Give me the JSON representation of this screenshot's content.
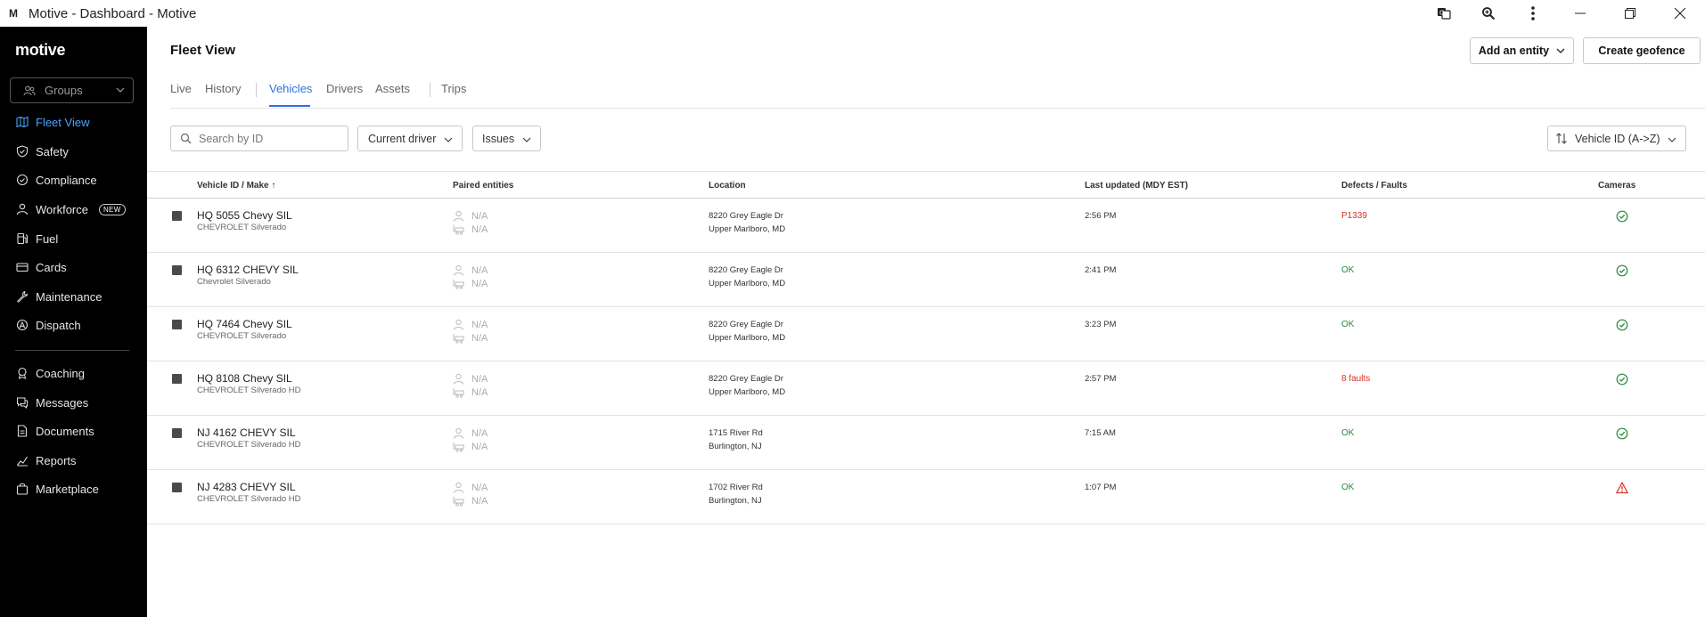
{
  "window": {
    "title": "Motive - Dashboard - Motive",
    "logo_text": "M"
  },
  "sidebar": {
    "logo": "motive",
    "groups_label": "Groups",
    "items": [
      {
        "label": "Fleet View",
        "icon": "map-icon",
        "active": true
      },
      {
        "label": "Safety",
        "icon": "shield-icon"
      },
      {
        "label": "Compliance",
        "icon": "compliance-icon"
      },
      {
        "label": "Workforce",
        "icon": "person-icon",
        "badge": "NEW"
      },
      {
        "label": "Fuel",
        "icon": "fuel-icon"
      },
      {
        "label": "Cards",
        "icon": "card-icon"
      },
      {
        "label": "Maintenance",
        "icon": "wrench-icon"
      },
      {
        "label": "Dispatch",
        "icon": "dispatch-icon"
      },
      {
        "label": "Coaching",
        "icon": "coaching-icon"
      },
      {
        "label": "Messages",
        "icon": "messages-icon"
      },
      {
        "label": "Documents",
        "icon": "documents-icon"
      },
      {
        "label": "Reports",
        "icon": "reports-icon"
      },
      {
        "label": "Marketplace",
        "icon": "marketplace-icon"
      }
    ]
  },
  "header": {
    "title": "Fleet View",
    "add_entity_label": "Add an entity",
    "create_geofence_label": "Create geofence"
  },
  "tabs": [
    "Live",
    "History",
    "Vehicles",
    "Drivers",
    "Assets",
    "Trips"
  ],
  "active_tab": "Vehicles",
  "filters": {
    "search_placeholder": "Search by ID",
    "current_driver_label": "Current driver",
    "issues_label": "Issues",
    "sort_label": "Vehicle ID (A->Z)"
  },
  "table": {
    "columns": {
      "vehicle": "Vehicle ID / Make",
      "sort_arrow": "↑",
      "paired": "Paired entities",
      "location": "Location",
      "updated": "Last updated (MDY EST)",
      "defects": "Defects / Faults",
      "cameras": "Cameras"
    },
    "rows": [
      {
        "id": "HQ 5055 Chevy SIL",
        "make": "CHEVROLET Silverado",
        "driver": "N/A",
        "trailer": "N/A",
        "loc1": "8220 Grey Eagle Dr",
        "loc2": "Upper Marlboro, MD",
        "updated": "2:56 PM",
        "defects": "P1339",
        "defect_status": "bad",
        "camera": "ok"
      },
      {
        "id": "HQ 6312 CHEVY SIL",
        "make": "Chevrolet Silverado",
        "driver": "N/A",
        "trailer": "N/A",
        "loc1": "8220 Grey Eagle Dr",
        "loc2": "Upper Marlboro, MD",
        "updated": "2:41 PM",
        "defects": "OK",
        "defect_status": "ok",
        "camera": "ok"
      },
      {
        "id": "HQ 7464 Chevy SIL",
        "make": "CHEVROLET Silverado",
        "driver": "N/A",
        "trailer": "N/A",
        "loc1": "8220 Grey Eagle Dr",
        "loc2": "Upper Marlboro, MD",
        "updated": "3:23 PM",
        "defects": "OK",
        "defect_status": "ok",
        "camera": "ok"
      },
      {
        "id": "HQ 8108 Chevy SIL",
        "make": "CHEVROLET Silverado HD",
        "driver": "N/A",
        "trailer": "N/A",
        "loc1": "8220 Grey Eagle Dr",
        "loc2": "Upper Marlboro, MD",
        "updated": "2:57 PM",
        "defects": "8 faults",
        "defect_status": "bad",
        "camera": "ok"
      },
      {
        "id": "NJ 4162 CHEVY SIL",
        "make": "CHEVROLET Silverado HD",
        "driver": "N/A",
        "trailer": "N/A",
        "loc1": "1715 River Rd",
        "loc2": "Burlington, NJ",
        "updated": "7:15 AM",
        "defects": "OK",
        "defect_status": "ok",
        "camera": "ok"
      },
      {
        "id": "NJ 4283 CHEVY SIL",
        "make": "CHEVROLET Silverado HD",
        "driver": "N/A",
        "trailer": "N/A",
        "loc1": "1702 River Rd",
        "loc2": "Burlington, NJ",
        "updated": "1:07 PM",
        "defects": "OK",
        "defect_status": "ok",
        "camera": "warning"
      }
    ]
  },
  "colors": {
    "accent": "#2f6fdc",
    "sidebar_active": "#4aa3ff",
    "ok_green": "#2a8a3a",
    "fault_red": "#d93025"
  }
}
